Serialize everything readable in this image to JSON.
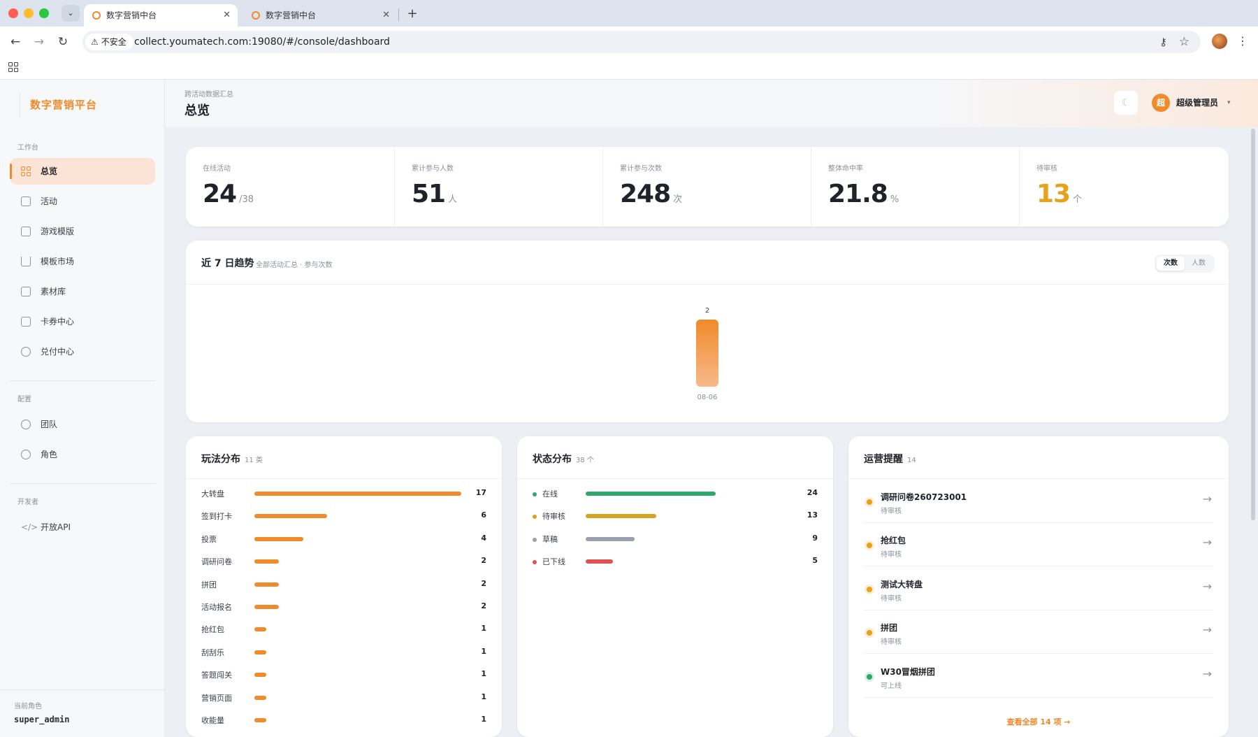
{
  "browser": {
    "tabs": [
      {
        "title": "数字营销中台",
        "active": true
      },
      {
        "title": "数字营销中台",
        "active": false
      }
    ],
    "security_label": "不安全",
    "url": "collect.youmatech.com:19080/#/console/dashboard"
  },
  "sidebar": {
    "brand": "数字营销平台",
    "sections": [
      {
        "label": "工作台"
      },
      {
        "label": "配置"
      },
      {
        "label": "开发者"
      }
    ],
    "items": [
      {
        "label": "总览",
        "icon": "dashboard-icon",
        "active": true
      },
      {
        "label": "活动",
        "icon": "document-icon"
      },
      {
        "label": "游戏模版",
        "icon": "gamepad-icon"
      },
      {
        "label": "模板市场",
        "icon": "cart-icon"
      },
      {
        "label": "素材库",
        "icon": "image-icon"
      },
      {
        "label": "卡券中心",
        "icon": "ticket-icon"
      },
      {
        "label": "兑付中心",
        "icon": "gift-icon"
      },
      {
        "label": "团队",
        "icon": "users-icon"
      },
      {
        "label": "角色",
        "icon": "shield-icon"
      },
      {
        "label": "开放API",
        "icon": "code-icon"
      }
    ],
    "footer": {
      "label": "当前角色",
      "value": "super_admin"
    }
  },
  "header": {
    "breadcrumb": "跨活动数据汇总",
    "title": "总览",
    "theme_glyph": "☾",
    "user": {
      "avatar_text": "超",
      "name": "超级管理员"
    }
  },
  "stats": [
    {
      "label": "在线活动",
      "value": "24",
      "unit": "/38"
    },
    {
      "label": "累计参与人数",
      "value": "51",
      "unit": "人"
    },
    {
      "label": "累计参与次数",
      "value": "248",
      "unit": "次"
    },
    {
      "label": "整体命中率",
      "value": "21.8",
      "unit": "%"
    },
    {
      "label": "待审核",
      "value": "13",
      "unit": "个",
      "highlight": true
    }
  ],
  "trend": {
    "title": "近 7 日趋势",
    "subtitle": "全部活动汇总 · 参与次数",
    "toggle": {
      "active": "次数",
      "inactive": "人数"
    }
  },
  "chart_data": {
    "type": "bar",
    "categories": [
      "08-06"
    ],
    "values": [
      2
    ],
    "title": "近 7 日趋势",
    "xlabel": "",
    "ylabel": "",
    "ylim": [
      0,
      2
    ],
    "grid": false,
    "color": "#f08a2a"
  },
  "play_distribution": {
    "title": "玩法分布",
    "count": "11 类",
    "max": 17,
    "color": "#f08a2a",
    "items": [
      {
        "label": "大转盘",
        "value": 17
      },
      {
        "label": "签到打卡",
        "value": 6
      },
      {
        "label": "投票",
        "value": 4
      },
      {
        "label": "调研问卷",
        "value": 2
      },
      {
        "label": "拼团",
        "value": 2
      },
      {
        "label": "活动报名",
        "value": 2
      },
      {
        "label": "抢红包",
        "value": 1
      },
      {
        "label": "刮刮乐",
        "value": 1
      },
      {
        "label": "答题闯关",
        "value": 1
      },
      {
        "label": "营销页面",
        "value": 1
      },
      {
        "label": "收能量",
        "value": 1
      }
    ]
  },
  "status_distribution": {
    "title": "状态分布",
    "count": "38 个",
    "max": 24,
    "items": [
      {
        "label": "在线",
        "value": 24,
        "color": "#2ea86a"
      },
      {
        "label": "待审核",
        "value": 13,
        "color": "#d9a11e"
      },
      {
        "label": "草稿",
        "value": 9,
        "color": "#9aa0aa"
      },
      {
        "label": "已下线",
        "value": 5,
        "color": "#e05252"
      }
    ]
  },
  "ops_alerts": {
    "title": "运营提醒",
    "count": "14",
    "items": [
      {
        "name": "调研问卷260723001",
        "status": "待审核",
        "color": "#e8a21a"
      },
      {
        "name": "抢红包",
        "status": "待审核",
        "color": "#e8a21a"
      },
      {
        "name": "测试大转盘",
        "status": "待审核",
        "color": "#e8a21a"
      },
      {
        "name": "拼团",
        "status": "待审核",
        "color": "#e8a21a"
      },
      {
        "name": "W30冒烟拼团",
        "status": "可上线",
        "color": "#2ea86a"
      }
    ],
    "view_all": "查看全部 14 项 →"
  }
}
